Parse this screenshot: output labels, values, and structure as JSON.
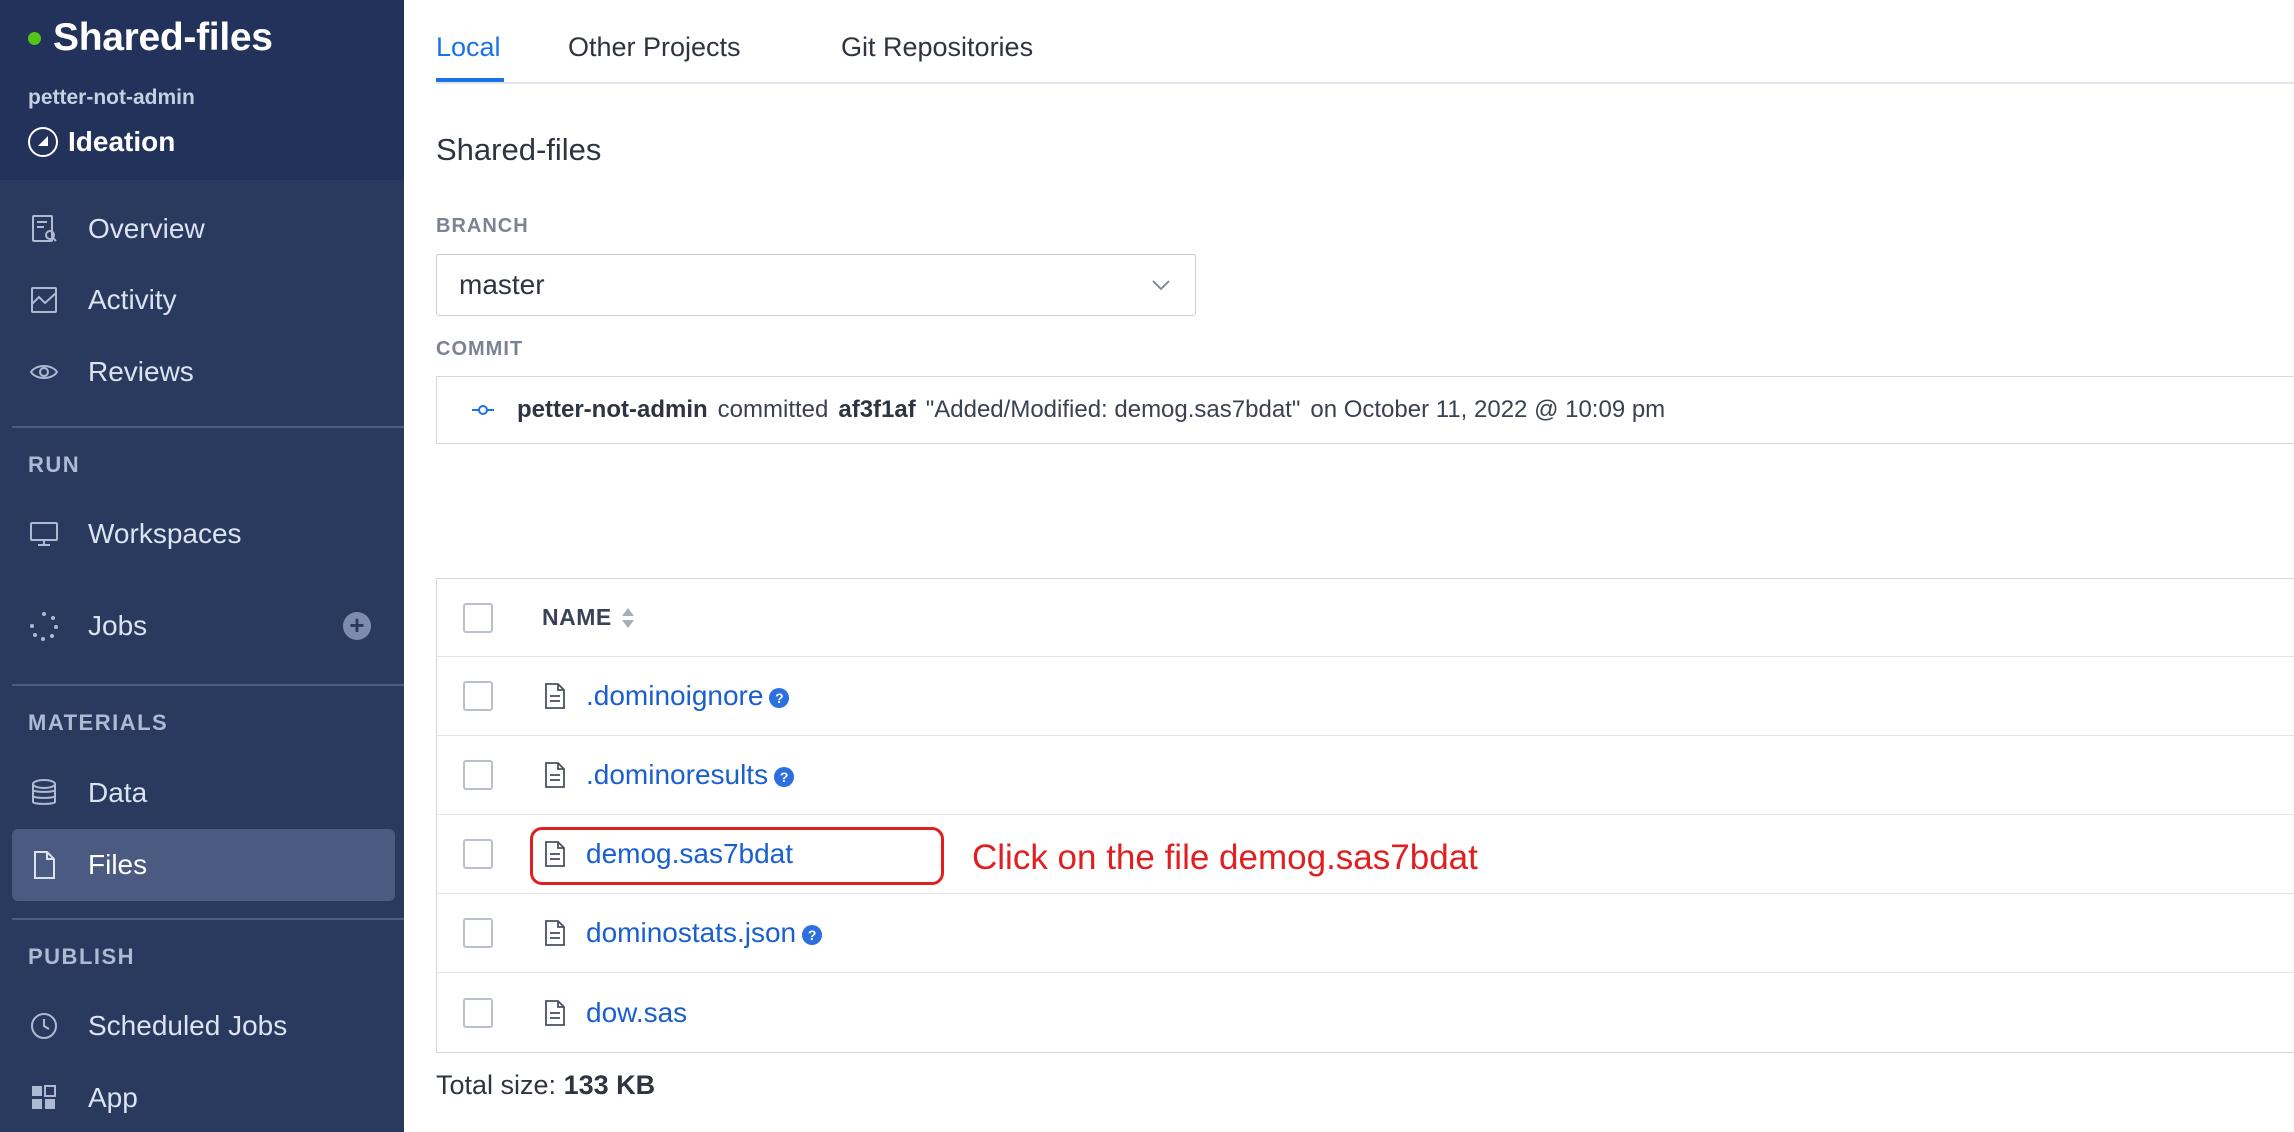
{
  "project": {
    "name": "Shared-files",
    "owner": "petter-not-admin",
    "stage": "Ideation",
    "status_color": "#52c41a"
  },
  "sidebar": {
    "items": [
      {
        "label": "Overview",
        "icon": "overview-icon"
      },
      {
        "label": "Activity",
        "icon": "activity-icon"
      },
      {
        "label": "Reviews",
        "icon": "eye-icon"
      }
    ],
    "sections": [
      {
        "title": "RUN",
        "items": [
          {
            "label": "Workspaces",
            "icon": "monitor-icon"
          },
          {
            "label": "Jobs",
            "icon": "jobs-spinner-icon",
            "action": "+"
          }
        ]
      },
      {
        "title": "MATERIALS",
        "items": [
          {
            "label": "Data",
            "icon": "database-icon"
          },
          {
            "label": "Files",
            "icon": "file-icon",
            "active": true
          }
        ]
      },
      {
        "title": "PUBLISH",
        "items": [
          {
            "label": "Scheduled Jobs",
            "icon": "clock-icon"
          },
          {
            "label": "App",
            "icon": "app-grid-icon"
          }
        ]
      }
    ]
  },
  "tabs": [
    {
      "label": "Local",
      "active": true
    },
    {
      "label": "Other Projects"
    },
    {
      "label": "Git Repositories"
    }
  ],
  "page_title": "Shared-files",
  "branch": {
    "label": "BRANCH",
    "value": "master"
  },
  "commit": {
    "label": "COMMIT",
    "author": "petter-not-admin",
    "verb": "committed",
    "hash": "af3f1af",
    "message": "\"Added/Modified: demog.sas7bdat\"",
    "date": "on October 11, 2022 @ 10:09 pm"
  },
  "table": {
    "column_name": "NAME",
    "files": [
      {
        "name": ".dominoignore",
        "help": "?"
      },
      {
        "name": ".dominoresults",
        "help": "?"
      },
      {
        "name": "demog.sas7bdat",
        "help": ""
      },
      {
        "name": "dominostats.json",
        "help": "?"
      },
      {
        "name": "dow.sas",
        "help": ""
      }
    ]
  },
  "annotation": {
    "text": "Click on the file demog.sas7bdat",
    "color": "#e02020"
  },
  "footer": {
    "total_label": "Total size:",
    "total_value": "133 KB"
  },
  "colors": {
    "sidebar": "#2a3a5f",
    "accent": "#1a73e8",
    "link": "#1a5fd0"
  }
}
